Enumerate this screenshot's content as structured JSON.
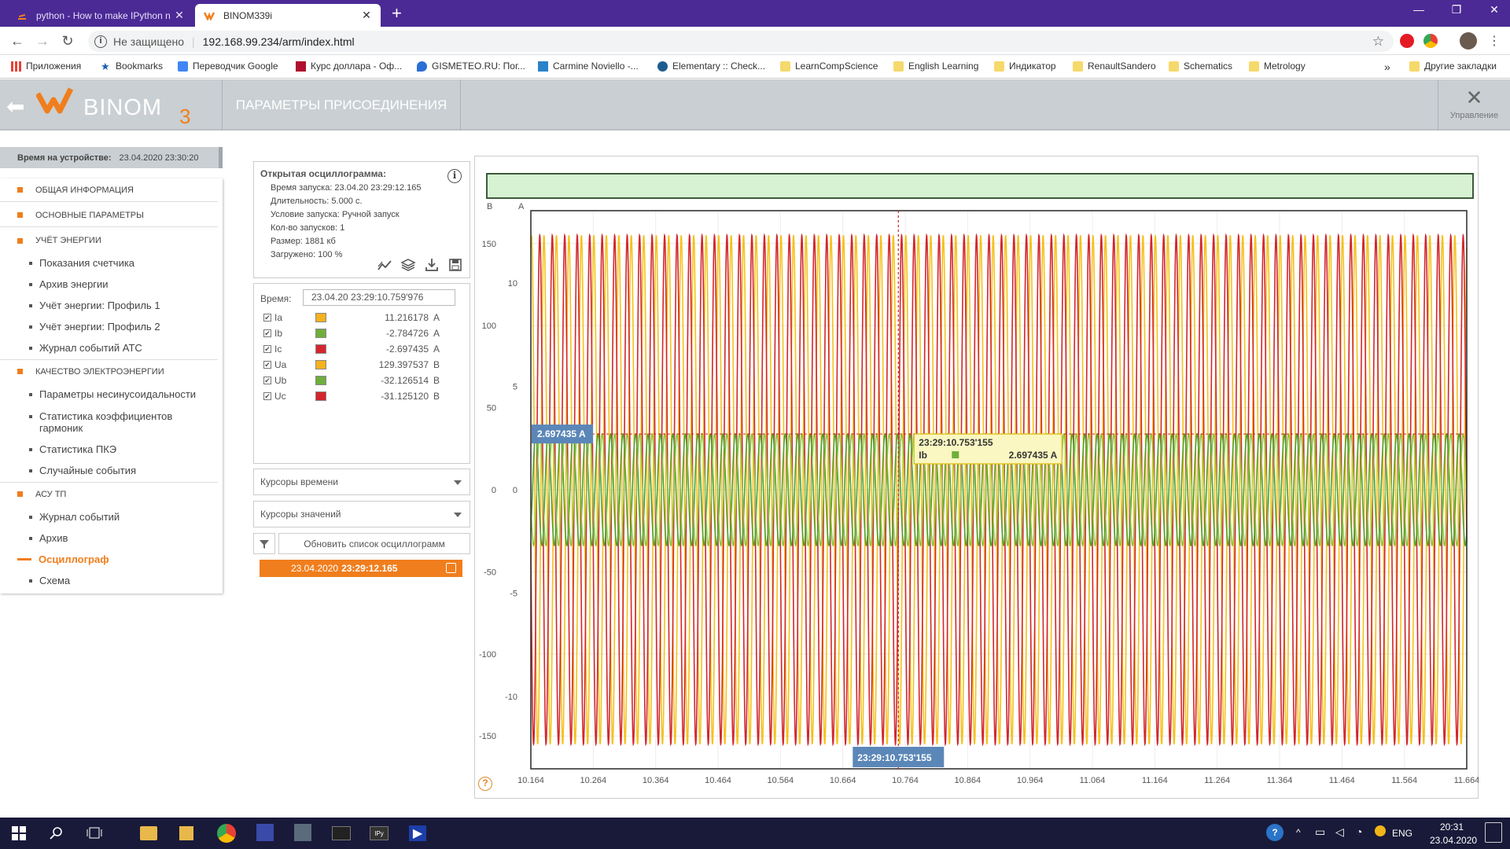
{
  "browser": {
    "tabs": [
      {
        "title": "python - How to make IPython n",
        "active": false
      },
      {
        "title": "BINOM339i",
        "active": true
      }
    ],
    "new_tab": "+",
    "address": {
      "security_label": "Не защищено",
      "url": "192.168.99.234/arm/index.html"
    },
    "bookmarks": [
      "Приложения",
      "Bookmarks",
      "Переводчик Google",
      "Курс доллара - Оф...",
      "GISMETEO.RU: Пог...",
      "Carmine Noviello -...",
      "Elementary :: Check...",
      "LearnCompScience",
      "English Learning",
      "Индикатор",
      "RenaultSandero",
      "Schematics",
      "Metrology"
    ],
    "bookmarks_more": "»",
    "other_bookmarks": "Другие закладки"
  },
  "app": {
    "logo_text": "BINOM",
    "logo_sub": "3",
    "section_title": "ПАРАМЕТРЫ ПРИСОЕДИНЕНИЯ",
    "manage_label": "Управление",
    "device_time_label": "Время на устройстве:",
    "device_time_value": "23.04.2020 23:30:20",
    "menu": {
      "sections": [
        {
          "label": "ОБЩАЯ ИНФОРМАЦИЯ"
        },
        {
          "label": "ОСНОВНЫЕ ПАРАМЕТРЫ"
        },
        {
          "label": "УЧЁТ ЭНЕРГИИ"
        },
        {
          "label": "КАЧЕСТВО ЭЛЕКТРОЭНЕРГИИ"
        },
        {
          "label": "АСУ ТП"
        }
      ],
      "items": [
        "Показания счетчика",
        "Архив энергии",
        "Учёт энергии: Профиль 1",
        "Учёт энергии: Профиль 2",
        "Журнал событий АТС",
        "Параметры несинусоидальности",
        "Статистика коэффициентов",
        "гармоник",
        "Статистика ПКЭ",
        "Случайные события",
        "Журнал событий",
        "Архив",
        "Осциллограф",
        "Схема"
      ]
    },
    "info": {
      "title": "Открытая осциллограмма:",
      "start_time": "Время запуска: 23.04.20 23:29:12.165",
      "duration": "Длительность: 5.000 с.",
      "trigger": "Условие запуска: Ручной запуск",
      "count": "Кол-во запусков: 1",
      "size": "Размер: 1881 кб",
      "loaded": "Загружено: 100 %"
    },
    "values": {
      "time_label": "Время:",
      "time_value": "23.04.20 23:29:10.759'976",
      "channels": [
        {
          "name": "Ia",
          "value": "11.216178",
          "unit": "A",
          "color": "#f5b21c",
          "checked": "✔"
        },
        {
          "name": "Ib",
          "value": "-2.784726",
          "unit": "A",
          "color": "#6eae3c",
          "checked": "✔"
        },
        {
          "name": "Ic",
          "value": "-2.697435",
          "unit": "A",
          "color": "#d2262c",
          "checked": "✔"
        },
        {
          "name": "Ua",
          "value": "129.397537",
          "unit": "B",
          "color": "#f5b21c",
          "checked": "✔"
        },
        {
          "name": "Ub",
          "value": "-32.126514",
          "unit": "B",
          "color": "#6eae3c",
          "checked": "✔"
        },
        {
          "name": "Uc",
          "value": "-31.125120",
          "unit": "B",
          "color": "#d2262c",
          "checked": "✔"
        }
      ]
    },
    "time_cursors": "Курсоры времени",
    "value_cursors": "Курсоры значений",
    "refresh_label": "Обновить список осциллограмм",
    "selected_record": {
      "date": "23.04.2020",
      "time": "23:29:12.165"
    }
  },
  "chart_data": {
    "type": "line",
    "title": "",
    "axis_left_unit": "B",
    "axis_right_unit": "A",
    "y_ticks_voltage": [
      150,
      100,
      50,
      0,
      -50,
      -100,
      -150
    ],
    "y_ticks_current": [
      10,
      5,
      0,
      -5,
      -10
    ],
    "ylim_voltage": [
      -170,
      170
    ],
    "ylim_current": [
      -13.5,
      13.5
    ],
    "x_ticks": [
      "10.164",
      "10.264",
      "10.364",
      "10.464",
      "10.564",
      "10.664",
      "10.764",
      "10.864",
      "10.964",
      "11.064",
      "11.164",
      "11.264",
      "11.364",
      "11.464",
      "11.564",
      "11.664"
    ],
    "xlim": [
      10.164,
      11.664
    ],
    "frequency_hz": 50,
    "series": [
      {
        "name": "Ua",
        "unit": "B",
        "amplitude": 155,
        "phase_deg": 0,
        "color": "#f5c21c"
      },
      {
        "name": "Uc",
        "unit": "B",
        "amplitude": 155,
        "phase_deg": 120,
        "color": "#d2262c"
      },
      {
        "name": "Ib",
        "unit": "A",
        "amplitude": 2.7,
        "phase_deg": -120,
        "color": "#4fa12e"
      },
      {
        "name": "Ic",
        "unit": "A",
        "amplitude": 2.7,
        "phase_deg": 120,
        "color": "#8cc63e"
      }
    ],
    "cursor": {
      "x": 10.753,
      "x_label": "23:29:10.753'155",
      "y_label": "2.697435 A",
      "tooltip_time": "23:29:10.753'155",
      "tooltip_series": "Ib",
      "tooltip_value": "2.697435 A"
    },
    "help": "?"
  },
  "taskbar": {
    "lang": "ENG",
    "time": "20:31",
    "date": "23.04.2020"
  }
}
